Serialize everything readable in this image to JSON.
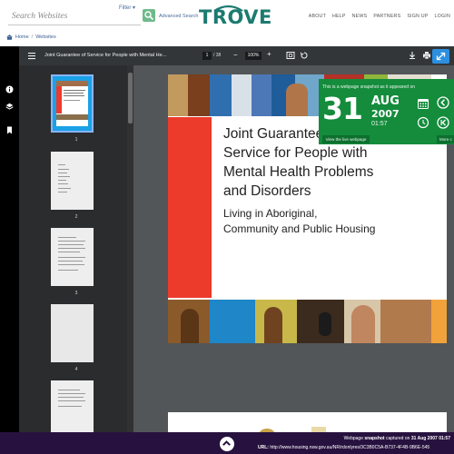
{
  "header": {
    "search_placeholder": "Search Websites",
    "filter_label": "Filter",
    "advanced_search_label": "Advanced Search",
    "logo_text": "TROVE",
    "nav": [
      "ABOUT",
      "HELP",
      "NEWS",
      "PARTNERS",
      "SIGN UP",
      "LOGIN"
    ]
  },
  "breadcrumb": {
    "home": "Home",
    "sep": "/",
    "current": "Websites"
  },
  "viewer": {
    "doc_title": "Joint Guarantee of Service for People with Mental He...",
    "page_current": "1",
    "page_sep": "/",
    "page_total": "38",
    "zoom": "100%",
    "minus": "−",
    "plus": "+",
    "thumbnail_labels": [
      "1",
      "2",
      "3",
      "4"
    ]
  },
  "document": {
    "title_lines": [
      "Joint Guarantee of",
      "Service for People with",
      "Mental Health Problems",
      "and Disorders"
    ],
    "subtitle_lines": [
      "Living in Aboriginal,",
      "Community and Public Housing"
    ]
  },
  "snapshot": {
    "caption": "This is a webpage snapshot as it appeared on",
    "day": "31",
    "month": "AUG",
    "year": "2007",
    "time": "01:57",
    "view_live": "View the live webpage",
    "more": "More c"
  },
  "footer": {
    "line1_prefix": "Webpage",
    "line1_bold1": "snapshot",
    "line1_mid": "captured on",
    "line1_bold2": "31 Aug 2007 01:57",
    "line2_label": "URL:",
    "line2_url": "http://www.housing.nsw.gov.au/NR/rdonlyres/3C3B0C5A-B737-4F4B-9B6E-545"
  },
  "colors": {
    "accent_green": "#148c3c",
    "trove_teal": "#1c7a70",
    "footer_purple": "#27123f",
    "cover_blue": "#1aa1e6",
    "cover_red": "#ec3a2b"
  }
}
